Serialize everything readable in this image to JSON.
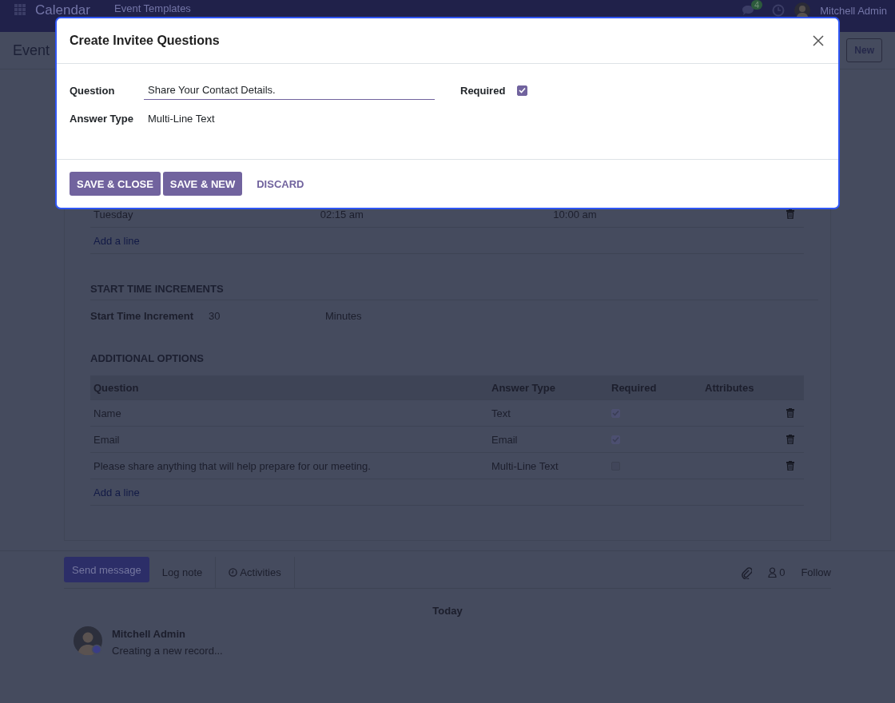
{
  "navbar": {
    "app_name": "Calendar",
    "breadcrumb": "Event Templates",
    "message_count": "4",
    "user_name": "Mitchell Admin"
  },
  "control_panel": {
    "title": "Event",
    "new_button": "New"
  },
  "availability": {
    "rows": [
      {
        "day": "Tuesday",
        "from": "02:15 am",
        "to": "10:00 am"
      }
    ],
    "add_line": "Add a line"
  },
  "start_time_increments": {
    "title": "START TIME INCREMENTS",
    "label": "Start Time Increment",
    "value": "30",
    "unit": "Minutes"
  },
  "additional_options": {
    "title": "ADDITIONAL OPTIONS",
    "columns": [
      "Question",
      "Answer Type",
      "Required",
      "Attributes"
    ],
    "rows": [
      {
        "question": "Name",
        "answer_type": "Text",
        "required": true
      },
      {
        "question": "Email",
        "answer_type": "Email",
        "required": true
      },
      {
        "question": "Please share anything that will help prepare for our meeting.",
        "answer_type": "Multi-Line Text",
        "required": false
      }
    ],
    "add_line": "Add a line"
  },
  "chatter": {
    "tabs": [
      "Send message",
      "Log note",
      "Activities"
    ],
    "follower_count": "0",
    "follow": "Follow",
    "date_separator": "Today",
    "messages": [
      {
        "author": "Mitchell Admin",
        "body": "Creating a new record..."
      }
    ]
  },
  "dialog": {
    "title": "Create Invitee Questions",
    "question_label": "Question",
    "question_value": "Share Your Contact Details.",
    "required_label": "Required",
    "required": true,
    "answer_type_label": "Answer Type",
    "answer_type_value": "Multi-Line Text",
    "buttons": [
      {
        "label": "SAVE & CLOSE",
        "kind": "primary"
      },
      {
        "label": "SAVE & NEW",
        "kind": "primary"
      },
      {
        "label": "DISCARD",
        "kind": "link"
      }
    ]
  }
}
